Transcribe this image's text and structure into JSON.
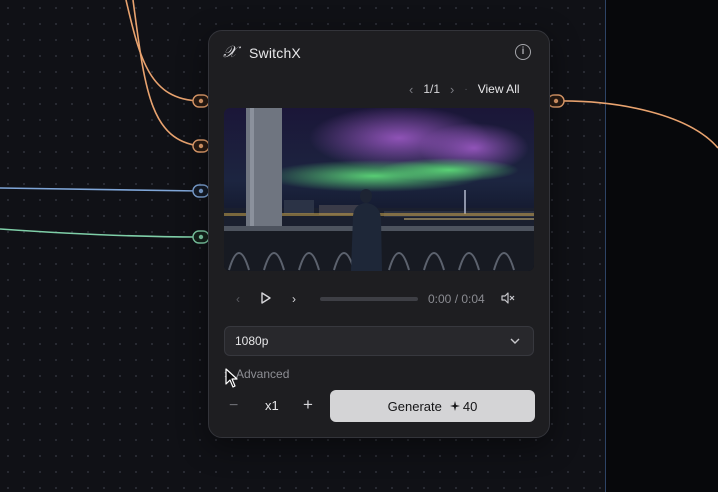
{
  "node": {
    "title": "SwitchX",
    "logo_glyph": "𝒳",
    "info_icon": "info-icon",
    "pager": {
      "current": "1/1",
      "view_all": "View All"
    },
    "preview": {
      "description": "aurora-over-city-bridge"
    },
    "player": {
      "time": "0:00 / 0:04",
      "progress_fraction": 0.0
    },
    "resolution": {
      "selected": "1080p"
    },
    "advanced_label": "Advanced",
    "quantity": {
      "value": "x1",
      "minus": "−",
      "plus": "+"
    },
    "generate": {
      "label": "Generate",
      "cost": "40",
      "cost_icon": "sparkle-icon"
    }
  },
  "colors": {
    "wire_orange": "#e9a36f",
    "wire_blue": "#7fa6d8",
    "wire_green": "#7fcfa8",
    "node_bg": "#1e1e21",
    "button_bg": "#d4d4d6"
  }
}
